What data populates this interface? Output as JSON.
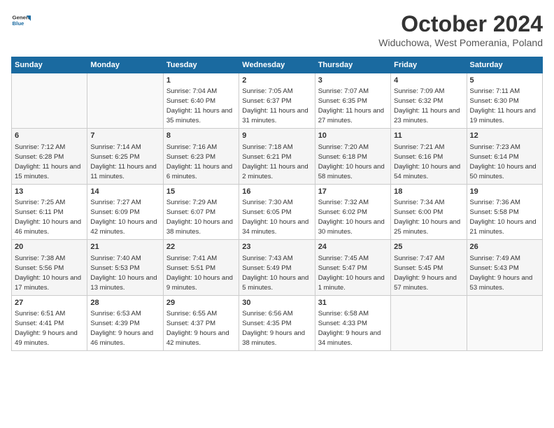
{
  "header": {
    "logo_general": "General",
    "logo_blue": "Blue",
    "month_title": "October 2024",
    "location": "Widuchowa, West Pomerania, Poland"
  },
  "weekdays": [
    "Sunday",
    "Monday",
    "Tuesday",
    "Wednesday",
    "Thursday",
    "Friday",
    "Saturday"
  ],
  "weeks": [
    [
      {
        "day": null
      },
      {
        "day": null
      },
      {
        "day": "1",
        "sunrise": "Sunrise: 7:04 AM",
        "sunset": "Sunset: 6:40 PM",
        "daylight": "Daylight: 11 hours and 35 minutes."
      },
      {
        "day": "2",
        "sunrise": "Sunrise: 7:05 AM",
        "sunset": "Sunset: 6:37 PM",
        "daylight": "Daylight: 11 hours and 31 minutes."
      },
      {
        "day": "3",
        "sunrise": "Sunrise: 7:07 AM",
        "sunset": "Sunset: 6:35 PM",
        "daylight": "Daylight: 11 hours and 27 minutes."
      },
      {
        "day": "4",
        "sunrise": "Sunrise: 7:09 AM",
        "sunset": "Sunset: 6:32 PM",
        "daylight": "Daylight: 11 hours and 23 minutes."
      },
      {
        "day": "5",
        "sunrise": "Sunrise: 7:11 AM",
        "sunset": "Sunset: 6:30 PM",
        "daylight": "Daylight: 11 hours and 19 minutes."
      }
    ],
    [
      {
        "day": "6",
        "sunrise": "Sunrise: 7:12 AM",
        "sunset": "Sunset: 6:28 PM",
        "daylight": "Daylight: 11 hours and 15 minutes."
      },
      {
        "day": "7",
        "sunrise": "Sunrise: 7:14 AM",
        "sunset": "Sunset: 6:25 PM",
        "daylight": "Daylight: 11 hours and 11 minutes."
      },
      {
        "day": "8",
        "sunrise": "Sunrise: 7:16 AM",
        "sunset": "Sunset: 6:23 PM",
        "daylight": "Daylight: 11 hours and 6 minutes."
      },
      {
        "day": "9",
        "sunrise": "Sunrise: 7:18 AM",
        "sunset": "Sunset: 6:21 PM",
        "daylight": "Daylight: 11 hours and 2 minutes."
      },
      {
        "day": "10",
        "sunrise": "Sunrise: 7:20 AM",
        "sunset": "Sunset: 6:18 PM",
        "daylight": "Daylight: 10 hours and 58 minutes."
      },
      {
        "day": "11",
        "sunrise": "Sunrise: 7:21 AM",
        "sunset": "Sunset: 6:16 PM",
        "daylight": "Daylight: 10 hours and 54 minutes."
      },
      {
        "day": "12",
        "sunrise": "Sunrise: 7:23 AM",
        "sunset": "Sunset: 6:14 PM",
        "daylight": "Daylight: 10 hours and 50 minutes."
      }
    ],
    [
      {
        "day": "13",
        "sunrise": "Sunrise: 7:25 AM",
        "sunset": "Sunset: 6:11 PM",
        "daylight": "Daylight: 10 hours and 46 minutes."
      },
      {
        "day": "14",
        "sunrise": "Sunrise: 7:27 AM",
        "sunset": "Sunset: 6:09 PM",
        "daylight": "Daylight: 10 hours and 42 minutes."
      },
      {
        "day": "15",
        "sunrise": "Sunrise: 7:29 AM",
        "sunset": "Sunset: 6:07 PM",
        "daylight": "Daylight: 10 hours and 38 minutes."
      },
      {
        "day": "16",
        "sunrise": "Sunrise: 7:30 AM",
        "sunset": "Sunset: 6:05 PM",
        "daylight": "Daylight: 10 hours and 34 minutes."
      },
      {
        "day": "17",
        "sunrise": "Sunrise: 7:32 AM",
        "sunset": "Sunset: 6:02 PM",
        "daylight": "Daylight: 10 hours and 30 minutes."
      },
      {
        "day": "18",
        "sunrise": "Sunrise: 7:34 AM",
        "sunset": "Sunset: 6:00 PM",
        "daylight": "Daylight: 10 hours and 25 minutes."
      },
      {
        "day": "19",
        "sunrise": "Sunrise: 7:36 AM",
        "sunset": "Sunset: 5:58 PM",
        "daylight": "Daylight: 10 hours and 21 minutes."
      }
    ],
    [
      {
        "day": "20",
        "sunrise": "Sunrise: 7:38 AM",
        "sunset": "Sunset: 5:56 PM",
        "daylight": "Daylight: 10 hours and 17 minutes."
      },
      {
        "day": "21",
        "sunrise": "Sunrise: 7:40 AM",
        "sunset": "Sunset: 5:53 PM",
        "daylight": "Daylight: 10 hours and 13 minutes."
      },
      {
        "day": "22",
        "sunrise": "Sunrise: 7:41 AM",
        "sunset": "Sunset: 5:51 PM",
        "daylight": "Daylight: 10 hours and 9 minutes."
      },
      {
        "day": "23",
        "sunrise": "Sunrise: 7:43 AM",
        "sunset": "Sunset: 5:49 PM",
        "daylight": "Daylight: 10 hours and 5 minutes."
      },
      {
        "day": "24",
        "sunrise": "Sunrise: 7:45 AM",
        "sunset": "Sunset: 5:47 PM",
        "daylight": "Daylight: 10 hours and 1 minute."
      },
      {
        "day": "25",
        "sunrise": "Sunrise: 7:47 AM",
        "sunset": "Sunset: 5:45 PM",
        "daylight": "Daylight: 9 hours and 57 minutes."
      },
      {
        "day": "26",
        "sunrise": "Sunrise: 7:49 AM",
        "sunset": "Sunset: 5:43 PM",
        "daylight": "Daylight: 9 hours and 53 minutes."
      }
    ],
    [
      {
        "day": "27",
        "sunrise": "Sunrise: 6:51 AM",
        "sunset": "Sunset: 4:41 PM",
        "daylight": "Daylight: 9 hours and 49 minutes."
      },
      {
        "day": "28",
        "sunrise": "Sunrise: 6:53 AM",
        "sunset": "Sunset: 4:39 PM",
        "daylight": "Daylight: 9 hours and 46 minutes."
      },
      {
        "day": "29",
        "sunrise": "Sunrise: 6:55 AM",
        "sunset": "Sunset: 4:37 PM",
        "daylight": "Daylight: 9 hours and 42 minutes."
      },
      {
        "day": "30",
        "sunrise": "Sunrise: 6:56 AM",
        "sunset": "Sunset: 4:35 PM",
        "daylight": "Daylight: 9 hours and 38 minutes."
      },
      {
        "day": "31",
        "sunrise": "Sunrise: 6:58 AM",
        "sunset": "Sunset: 4:33 PM",
        "daylight": "Daylight: 9 hours and 34 minutes."
      },
      {
        "day": null
      },
      {
        "day": null
      }
    ]
  ]
}
